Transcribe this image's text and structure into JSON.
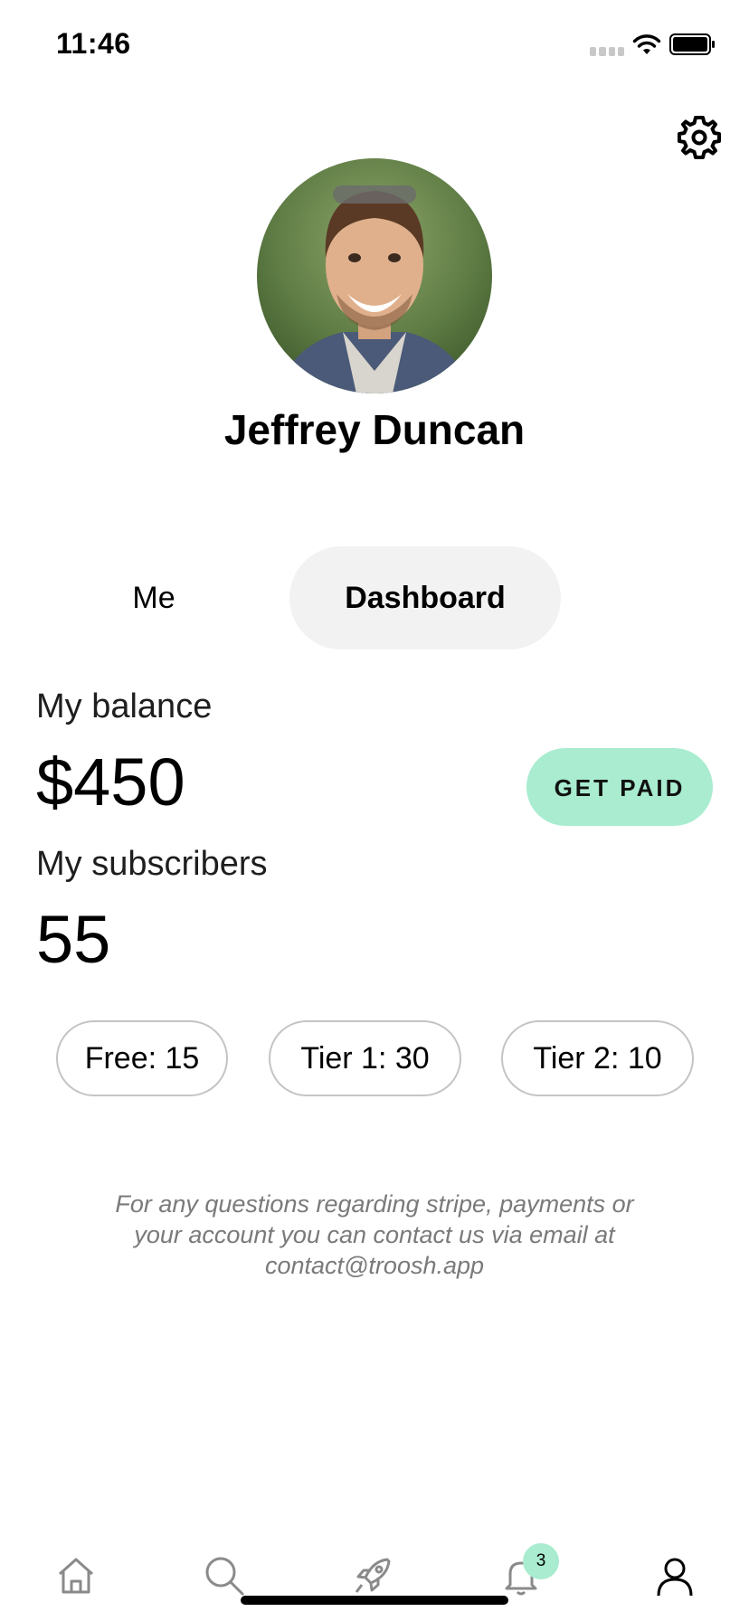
{
  "status_bar": {
    "time": "11:46"
  },
  "profile": {
    "name": "Jeffrey Duncan"
  },
  "tabs": [
    {
      "label": "Me",
      "active": false
    },
    {
      "label": "Dashboard",
      "active": true
    }
  ],
  "dashboard": {
    "balance_label": "My balance",
    "balance_value": "$450",
    "get_paid_label": "GET PAID",
    "subscribers_label": "My subscribers",
    "subscribers_value": "55",
    "tiers": [
      {
        "label": "Free: 15"
      },
      {
        "label": "Tier 1: 30"
      },
      {
        "label": "Tier 2: 10"
      }
    ]
  },
  "note": "For any questions regarding stripe, payments or your account you can contact us via email at contact@troosh.app",
  "bottom_nav": {
    "items": [
      "home-icon",
      "search-icon",
      "rocket-icon",
      "bell-icon",
      "profile-icon"
    ],
    "notification_count": "3"
  },
  "colors": {
    "accent": "#a9ecd0",
    "tab_active_bg": "#f2f2f2",
    "pill_border": "#c4c4c4",
    "note_text": "#7a7a7a"
  }
}
